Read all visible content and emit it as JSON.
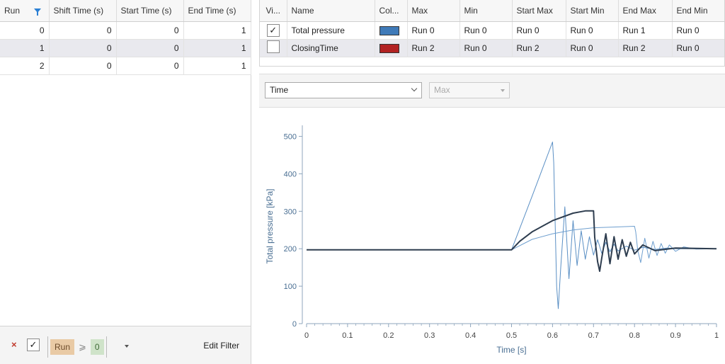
{
  "runs_table": {
    "columns": [
      "Run",
      "Shift Time (s)",
      "Start Time (s)",
      "End Time (s)"
    ],
    "rows": [
      [
        "0",
        "0",
        "0",
        "1"
      ],
      [
        "1",
        "0",
        "0",
        "1"
      ],
      [
        "2",
        "0",
        "0",
        "1"
      ]
    ]
  },
  "filter_bar": {
    "clear_icon": "×",
    "enabled_check": "✓",
    "field": "Run",
    "operator": "⩾",
    "value": "0",
    "edit_label": "Edit Filter"
  },
  "variables_table": {
    "columns": [
      "Vi...",
      "Name",
      "Col...",
      "Max",
      "Min",
      "Start Max",
      "Start Min",
      "End Max",
      "End Min"
    ],
    "rows": [
      {
        "visible": "✓",
        "name": "Total pressure",
        "color": "#3f7ab8",
        "max": "Run 0",
        "min": "Run 0",
        "start_max": "Run 0",
        "start_min": "Run 0",
        "end_max": "Run 1",
        "end_min": "Run 0"
      },
      {
        "visible": "",
        "name": "ClosingTime",
        "color": "#b22222",
        "max": "Run 2",
        "min": "Run 0",
        "start_max": "Run 2",
        "start_min": "Run 0",
        "end_max": "Run 2",
        "end_min": "Run 0"
      }
    ]
  },
  "axis_bar": {
    "x_select": "Time",
    "mode_select": "Max"
  },
  "chart_data": {
    "type": "line",
    "xlabel": "Time [s]",
    "ylabel": "Total pressure [kPa]",
    "xlim": [
      0,
      1
    ],
    "ylim": [
      0,
      520
    ],
    "xticks": [
      "0",
      "0.1",
      "0.2",
      "0.3",
      "0.4",
      "0.5",
      "0.6",
      "0.7",
      "0.8",
      "0.9",
      "1"
    ],
    "yticks": [
      "0",
      "100",
      "200",
      "300",
      "400",
      "500"
    ],
    "grid": false,
    "legend": "none",
    "series": [
      {
        "color": "#5a8fc4",
        "width": 1,
        "x": [
          0,
          0.5,
          0.55,
          0.6,
          0.603,
          0.61,
          0.614,
          0.62,
          0.63,
          0.64,
          0.65,
          0.66,
          0.67,
          0.68,
          0.69,
          0.7,
          0.71,
          0.72,
          0.73,
          0.74,
          0.75,
          0.76,
          0.78,
          0.8,
          0.82,
          0.85,
          0.88,
          0.9,
          1
        ],
        "y": [
          197,
          197,
          340,
          485,
          430,
          100,
          40,
          150,
          312,
          120,
          275,
          155,
          248,
          172,
          232,
          183,
          224,
          188,
          217,
          192,
          212,
          194,
          207,
          196,
          204,
          198,
          202,
          200,
          200
        ]
      },
      {
        "color": "#6e9fcf",
        "width": 1,
        "x": [
          0,
          0.5,
          0.55,
          0.6,
          0.65,
          0.7,
          0.75,
          0.8,
          0.803,
          0.808,
          0.815,
          0.825,
          0.835,
          0.845,
          0.855,
          0.865,
          0.875,
          0.885,
          0.9,
          0.92,
          0.95,
          1
        ],
        "y": [
          197,
          197,
          225,
          240,
          250,
          256,
          258,
          260,
          245,
          195,
          163,
          228,
          175,
          220,
          182,
          214,
          188,
          210,
          193,
          205,
          199,
          200
        ]
      },
      {
        "color": "#2e3d4f",
        "width": 2,
        "x": [
          0,
          0.5,
          0.52,
          0.55,
          0.6,
          0.65,
          0.68,
          0.7,
          0.703,
          0.71,
          0.715,
          0.72,
          0.73,
          0.74,
          0.75,
          0.76,
          0.77,
          0.78,
          0.79,
          0.8,
          0.82,
          0.85,
          0.9,
          1
        ],
        "y": [
          197,
          197,
          220,
          245,
          275,
          295,
          301,
          301,
          230,
          165,
          140,
          175,
          240,
          160,
          232,
          172,
          224,
          180,
          217,
          186,
          210,
          195,
          202,
          200
        ]
      }
    ]
  }
}
